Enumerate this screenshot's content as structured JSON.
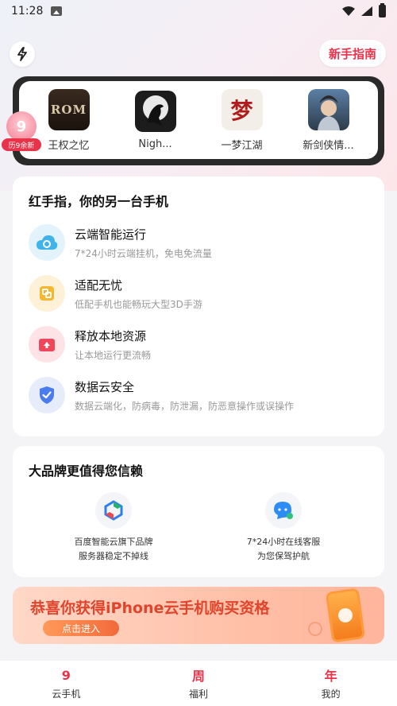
{
  "status_bar": {
    "time": "11:28"
  },
  "header": {
    "guide_label": "新手指南"
  },
  "games": [
    {
      "name": "王权之忆",
      "icon_text": "ROM"
    },
    {
      "name": "Nigh...",
      "icon_text": ""
    },
    {
      "name": "一梦江湖",
      "icon_text": "梦"
    },
    {
      "name": "新剑侠情...",
      "icon_text": ""
    }
  ],
  "promo_badge": {
    "label": "历9余新"
  },
  "features": {
    "title": "红手指，你的另一台手机",
    "items": [
      {
        "title": "云端智能运行",
        "desc": "7*24小时云端挂机，免电免流量",
        "icon": "cloud-icon"
      },
      {
        "title": "适配无忧",
        "desc": "低配手机也能畅玩大型3D手游",
        "icon": "adapt-icon"
      },
      {
        "title": "释放本地资源",
        "desc": "让本地运行更流畅",
        "icon": "release-icon"
      },
      {
        "title": "数据云安全",
        "desc": "数据云端化，防病毒，防泄漏，防恶意操作或误操作",
        "icon": "shield-icon"
      }
    ]
  },
  "trust": {
    "title": "大品牌更值得您信赖",
    "items": [
      {
        "line1": "百度智能云旗下品牌",
        "line2": "服务器稳定不掉线",
        "icon": "baidu-cloud-icon"
      },
      {
        "line1": "7*24小时在线客服",
        "line2": "为您保驾护航",
        "icon": "chat-service-icon"
      }
    ]
  },
  "banner": {
    "text": "恭喜你获得iPhone云手机购买资格",
    "button": "点击进入"
  },
  "bottom_nav": [
    {
      "icon_text": "9",
      "label": "云手机"
    },
    {
      "icon_text": "周",
      "label": "福利"
    },
    {
      "icon_text": "年",
      "label": "我的"
    }
  ],
  "colors": {
    "accent": "#e8334a",
    "banner_text": "#e0442b"
  }
}
